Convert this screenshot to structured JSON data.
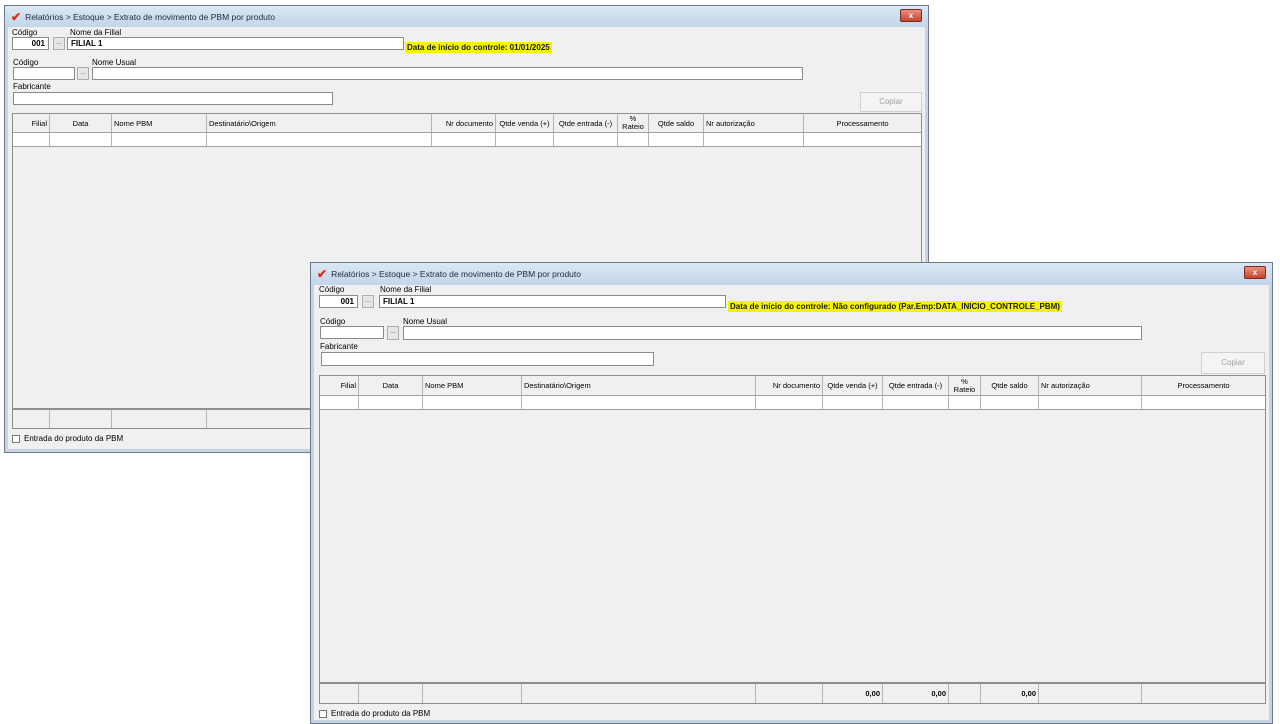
{
  "title": "Relatórios > Estoque > Extrato de movimento de PBM por produto",
  "close_label": "x",
  "labels": {
    "codigo": "Código",
    "nome_filial": "Nome da Filial",
    "codigo_produto": "Código",
    "nome_usual": "Nome Usual",
    "fabricante": "Fabricante",
    "browse": "..."
  },
  "copy_button": "Copiar",
  "columns": [
    "Filial",
    "Data",
    "Nome PBM",
    "Destinatário\\Origem",
    "Nr documento",
    "Qtde venda (+)",
    "Qtde entrada (-)",
    "% Rateio",
    "Qtde saldo",
    "Nr autorização",
    "Processamento"
  ],
  "checkbox_label": "Entrada do produto da PBM",
  "windows": [
    {
      "filial_codigo": "001",
      "filial_nome": "FILIAL 1",
      "control_date": "Data de início do controle: 01/01/2025"
    },
    {
      "filial_codigo": "001",
      "filial_nome": "FILIAL 1",
      "control_date": "Data de início do controle: Não configurado (Par.Emp:DATA_INICIO_CONTROLE_PBM)",
      "totals": {
        "venda": "0,00",
        "entrada": "0,00",
        "saldo": "0,00"
      }
    }
  ]
}
